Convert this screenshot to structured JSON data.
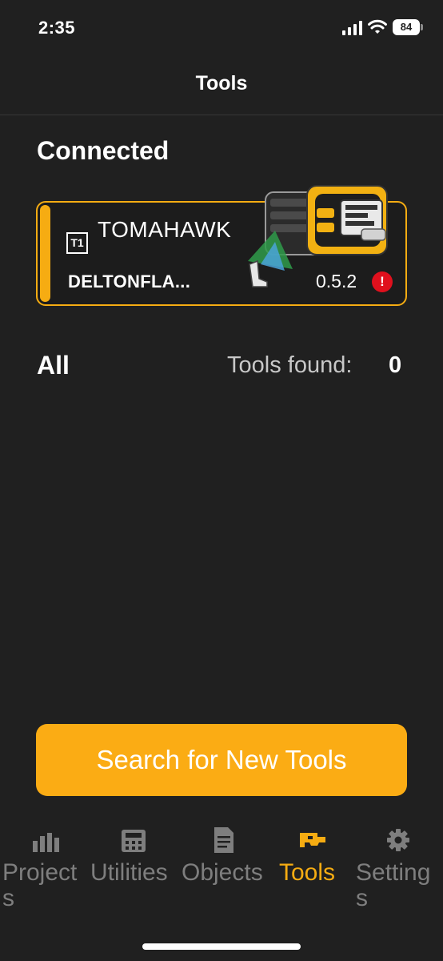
{
  "status_bar": {
    "time": "2:35",
    "battery": "84"
  },
  "header": {
    "title": "Tools"
  },
  "connected": {
    "heading": "Connected",
    "tool": {
      "badge": "T1",
      "name": "TOMAHAWK",
      "device": "DELTONFLA...",
      "version": "0.5.2",
      "warning_icon": "exclamation-icon"
    }
  },
  "all": {
    "heading": "All",
    "tools_found_label": "Tools found:",
    "tools_found_count": "0"
  },
  "search_button": {
    "label": "Search for New Tools"
  },
  "bottom_nav": {
    "items": [
      {
        "label": "Projects",
        "icon": "bar-chart-icon"
      },
      {
        "label": "Utilities",
        "icon": "calculator-icon"
      },
      {
        "label": "Objects",
        "icon": "document-icon"
      },
      {
        "label": "Tools",
        "icon": "tool-icon",
        "active": true
      },
      {
        "label": "Settings",
        "icon": "gear-icon"
      }
    ]
  },
  "colors": {
    "accent": "#f6ac12",
    "background": "#202020",
    "inactive": "#7e7e7e",
    "warning": "#e0101d"
  }
}
